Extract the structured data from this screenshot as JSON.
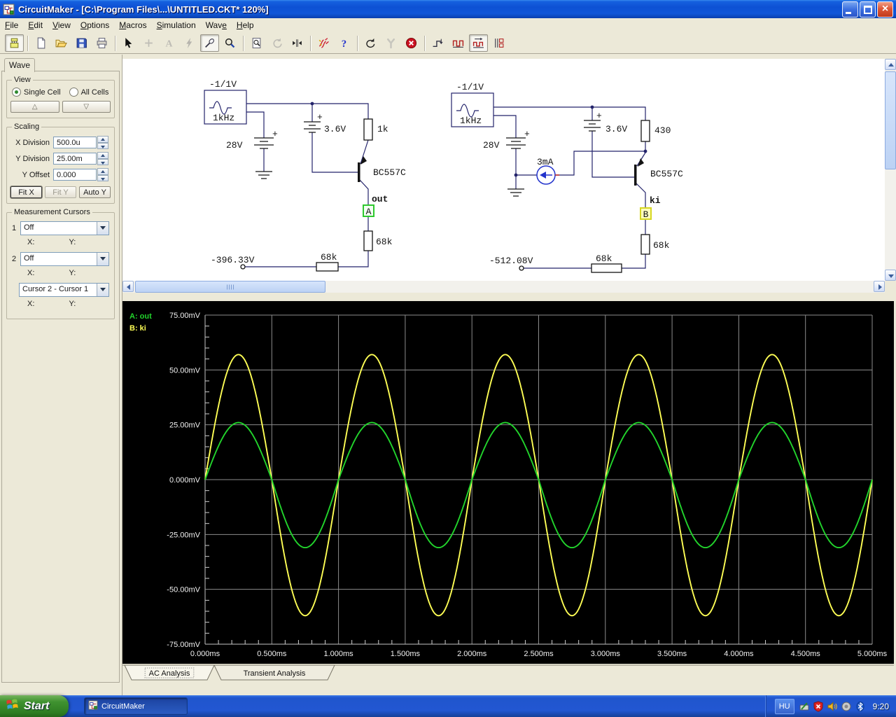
{
  "window": {
    "title": "CircuitMaker - [C:\\Program Files\\...\\UNTITLED.CKT* 120%]",
    "controls": [
      "minimize-button",
      "restore-button",
      "close-button"
    ]
  },
  "menu": {
    "items": [
      {
        "label": "File",
        "u": 0
      },
      {
        "label": "Edit",
        "u": 0
      },
      {
        "label": "View",
        "u": 0
      },
      {
        "label": "Options",
        "u": 0
      },
      {
        "label": "Macros",
        "u": 0
      },
      {
        "label": "Simulation",
        "u": 0
      },
      {
        "label": "Wave",
        "u": 3
      },
      {
        "label": "Help",
        "u": 0
      }
    ]
  },
  "toolbar": {
    "buttons": [
      {
        "name": "browse-button",
        "icon": "chip-icon",
        "pressed": true
      },
      {
        "name": "new-button",
        "icon": "new-page-icon",
        "group": true
      },
      {
        "name": "open-button",
        "icon": "open-folder-icon"
      },
      {
        "name": "save-button",
        "icon": "save-icon"
      },
      {
        "name": "print-button",
        "icon": "print-icon"
      },
      {
        "name": "select-button",
        "icon": "cursor-icon",
        "group": true
      },
      {
        "name": "place-part-button",
        "icon": "plus-icon",
        "disabled": true
      },
      {
        "name": "text-button",
        "icon": "text-icon",
        "disabled": true
      },
      {
        "name": "delete-button",
        "icon": "lightning-icon",
        "disabled": true
      },
      {
        "name": "probe-button",
        "icon": "probe-icon",
        "pressed": true
      },
      {
        "name": "zoom-button",
        "icon": "magnifier-icon"
      },
      {
        "name": "preview-button",
        "icon": "preview-page-icon",
        "group": true
      },
      {
        "name": "rotate-button",
        "icon": "rotate-icon",
        "disabled": true
      },
      {
        "name": "mirror-button",
        "icon": "splitter-icon"
      },
      {
        "name": "analyses-button",
        "icon": "analyses-icon",
        "group": true
      },
      {
        "name": "help-button",
        "icon": "question-icon"
      },
      {
        "name": "reset-button",
        "icon": "undo-icon",
        "group": true
      },
      {
        "name": "probe-tool-button",
        "icon": "wrench-icon",
        "disabled": true
      },
      {
        "name": "stop-button",
        "icon": "stop-icon"
      },
      {
        "name": "step-display-button",
        "icon": "scope-step-icon",
        "group": true
      },
      {
        "name": "digital-wave-button",
        "icon": "square-wave-icon"
      },
      {
        "name": "analog-wave-button",
        "icon": "square-wave-arrow-icon",
        "pressed": true
      },
      {
        "name": "logic-display-button",
        "icon": "logic-display-icon"
      }
    ]
  },
  "sidebar": {
    "tab_label": "Wave",
    "view": {
      "title": "View",
      "options": [
        {
          "label": "Single Cell",
          "selected": true
        },
        {
          "label": "All Cells",
          "selected": false
        }
      ],
      "up_button": "△",
      "down_button": "▽"
    },
    "scaling": {
      "title": "Scaling",
      "fields": [
        {
          "label": "X Division",
          "value": "500.0u"
        },
        {
          "label": "Y Division",
          "value": "25.00m"
        },
        {
          "label": "Y Offset",
          "value": "0.000"
        }
      ],
      "buttons": [
        {
          "label": "Fit X",
          "enabled": true,
          "default": true
        },
        {
          "label": "Fit Y",
          "enabled": false
        },
        {
          "label": "Auto Y",
          "enabled": true
        }
      ]
    },
    "cursors": {
      "title": "Measurement Cursors",
      "cursor1_label": "1",
      "cursor1_value": "Off",
      "cursor2_label": "2",
      "cursor2_value": "Off",
      "diff_value": "Cursor 2 - Cursor 1",
      "x_label": "X:",
      "y_label": "Y:"
    }
  },
  "schematic": {
    "circuit1": {
      "source_amplitude": "-1/1V",
      "source_frequency": "1kHz",
      "battery_main": "28V",
      "battery_main_plus": "+",
      "battery_bias": "3.6V",
      "battery_bias_plus": "+",
      "resistor_collector": "1k",
      "transistor": "BC557C",
      "net_label": "out",
      "probe_label": "A",
      "resistor_load": "68k",
      "resistor_series": "68k",
      "node_voltage": "-396.33V"
    },
    "circuit2": {
      "source_amplitude": "-1/1V",
      "source_frequency": "1kHz",
      "battery_main": "28V",
      "battery_main_plus": "+",
      "current_source": "3mA",
      "battery_bias": "3.6V",
      "battery_bias_plus": "+",
      "resistor_collector": "430",
      "transistor": "BC557C",
      "net_label": "ki",
      "probe_label": "B",
      "resistor_load": "68k",
      "resistor_series": "68k",
      "node_voltage": "-512.08V"
    }
  },
  "wave_panel": {
    "tabs": [
      {
        "label": "AC Analysis",
        "active": true
      },
      {
        "label": "Transient Analysis",
        "active": false
      }
    ]
  },
  "chart_data": {
    "type": "line",
    "title": "",
    "x_unit": "ms",
    "y_unit": "mV",
    "xlim": [
      0,
      5
    ],
    "ylim": [
      -75,
      75
    ],
    "x_ticks": [
      "0.000ms",
      "0.500ms",
      "1.000ms",
      "1.500ms",
      "2.000ms",
      "2.500ms",
      "3.000ms",
      "3.500ms",
      "4.000ms",
      "4.500ms",
      "5.000ms"
    ],
    "y_ticks": [
      "75.00mV",
      "50.00mV",
      "25.00mV",
      "0.000mV",
      "-25.00mV",
      "-50.00mV",
      "-75.00mV"
    ],
    "grid": {
      "on": true,
      "x_major_ms": 0.5,
      "x_minor_ms": 0.1,
      "y_major_mv": 25,
      "y_minor_mv": 5
    },
    "legend_position": "top-left",
    "background": "#000000",
    "series": [
      {
        "name": "A: out",
        "signal": "out",
        "color": "#22d42c",
        "shape": "sine",
        "frequency_khz": 1,
        "cycles_shown": 5,
        "peak_mv": 26,
        "trough_mv": -31,
        "phase_deg": 0
      },
      {
        "name": "B: ki",
        "signal": "ki",
        "color": "#ffff55",
        "shape": "sine",
        "frequency_khz": 1,
        "cycles_shown": 5,
        "peak_mv": 57,
        "trough_mv": -62,
        "phase_deg": 0
      }
    ]
  },
  "taskbar": {
    "start_label": "Start",
    "task_label": "CircuitMaker",
    "tray": {
      "language": "HU",
      "time": "9:20",
      "icons": [
        "pen-tablet-icon",
        "security-alert-icon",
        "volume-icon",
        "audio-device-icon",
        "bluetooth-icon"
      ]
    }
  }
}
